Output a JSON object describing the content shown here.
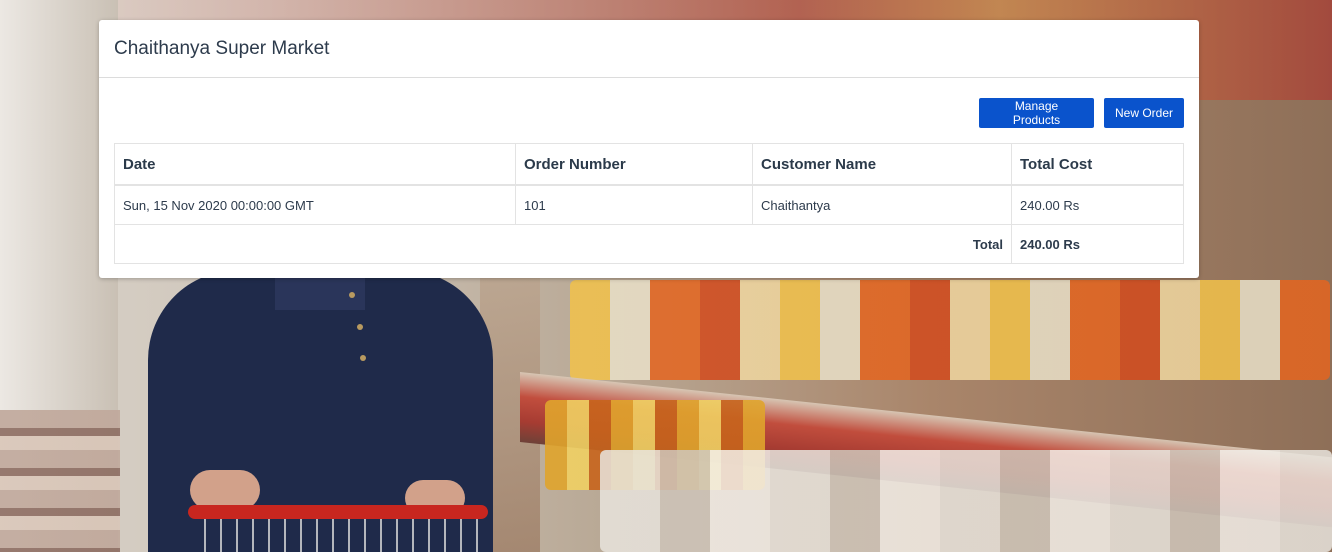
{
  "header": {
    "title": "Chaithanya Super Market"
  },
  "toolbar": {
    "manage_products_label": "Manage Products",
    "new_order_label": "New Order"
  },
  "colors": {
    "primary_button": "#0a53cc",
    "title_text": "#2d3b4c"
  },
  "orders": {
    "columns": [
      "Date",
      "Order Number",
      "Customer Name",
      "Total Cost"
    ],
    "rows": [
      {
        "date": "Sun, 15 Nov 2020 00:00:00 GMT",
        "order_number": "101",
        "customer_name": "Chaithantya",
        "total_cost": "240.00 Rs"
      }
    ],
    "total_label": "Total",
    "total_value": "240.00 Rs"
  }
}
